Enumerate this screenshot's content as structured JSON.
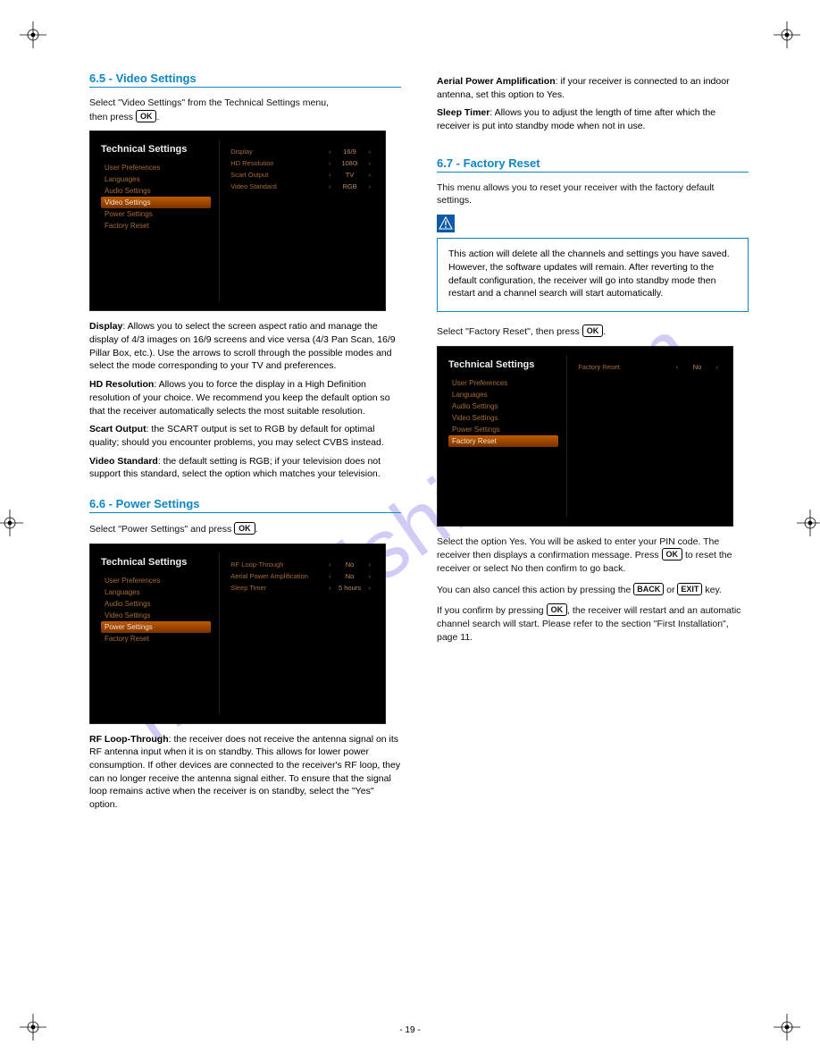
{
  "watermark": "manualshive.com",
  "left": {
    "section1_title": "6.5 - Video Settings",
    "section1_intro_a": "Select \"Video Settings\" from the Technical Settings menu,",
    "section1_intro_b": "then press ",
    "ok": "OK",
    "section1_intro_c": ".",
    "display_label": "Display",
    "display_body": ": Allows you to select the screen aspect ratio and manage the display of 4/3 images on 16/9 screens and vice versa (4/3 Pan Scan, 16/9 Pillar Box, etc.). Use the arrows to scroll through the possible modes and select the mode corresponding to your TV and preferences.",
    "hdres_label": "HD Resolution",
    "hdres_body": ": Allows you to force the display in a High Definition resolution of your choice. We recommend you keep the default option so that the receiver automatically selects the most suitable resolution.",
    "scart_label": "Scart Output",
    "scart_body": ": the SCART output is set to RGB by default for optimal quality; should you encounter problems, you may select CVBS instead.",
    "vstd_label": "Video Standard",
    "vstd_body": ": the default setting is RGB; if your television does not support this standard, select the option which matches your television.",
    "section2_title": "6.6 - Power Settings",
    "section2_intro_a": "Select \"Power Settings\" and press ",
    "rf_label": "RF Loop-Through",
    "rf_body": ": the receiver does not receive the antenna signal on its RF antenna input when it is on standby. This allows for lower power consumption. If other devices are connected to the receiver's RF loop, they can no longer receive the antenna signal either. To ensure that the signal loop remains active when the receiver is on standby, select the \"Yes\" option.",
    "screenshot1": {
      "title": "Technical Settings",
      "items": [
        "User Preferences",
        "Languages",
        "Audio Settings",
        "Video Settings",
        "Power Settings",
        "Factory Reset"
      ],
      "active_index": 3,
      "options": [
        {
          "label": "Display",
          "value": "16/9"
        },
        {
          "label": "HD Resolution",
          "value": "1080i"
        },
        {
          "label": "Scart Output",
          "value": "TV"
        },
        {
          "label": "Video Standard",
          "value": "RGB"
        }
      ]
    },
    "screenshot2": {
      "title": "Technical Settings",
      "items": [
        "User Preferences",
        "Languages",
        "Audio Settings",
        "Video Settings",
        "Power Settings",
        "Factory Reset"
      ],
      "active_index": 4,
      "options": [
        {
          "label": "RF Loop-Through",
          "value": "No"
        },
        {
          "label": "Aerial Power Amplification",
          "value": "No"
        },
        {
          "label": "Sleep Timer",
          "value": "5 hours"
        }
      ]
    }
  },
  "right": {
    "apa_label": "Aerial Power Amplification",
    "apa_body": ": if your receiver is connected to an indoor antenna, set this option to Yes.",
    "sleep_label": "Sleep Timer",
    "sleep_body": ": Allows you to adjust the length of time after which the receiver is put into standby mode when not in use.",
    "section_title": "6.7 - Factory Reset",
    "section_lead": "This menu allows you to reset your receiver with the factory default settings.",
    "warn_text": "This action will delete all the channels and settings you have saved. However, the software updates will remain. After reverting to the default configuration, the receiver will go into standby mode then restart and a channel search will start automatically.",
    "intro_a": "Select \"Factory Reset\", then press ",
    "screenshot3": {
      "title": "Technical Settings",
      "items": [
        "User Preferences",
        "Languages",
        "Audio Settings",
        "Video Settings",
        "Power Settings",
        "Factory Reset"
      ],
      "active_index": 5,
      "options": [
        {
          "label": "Factory Reset",
          "value": "No"
        }
      ]
    },
    "after1": "Select the option Yes. You will be asked to enter your PIN code. The receiver then displays a confirmation message. Press ",
    "after1b": " to reset the receiver or select No then confirm to go back.",
    "after2a": "You can also cancel this action by pressing the ",
    "back": "BACK",
    "after2b": " or ",
    "exit": "EXIT",
    "after2c": " key.",
    "after3a": "If you confirm by pressing ",
    "after3b": ", the receiver will restart and an automatic channel search will start. Please refer to the section \"First Installation\", page 11.",
    "footer": "- 19 -"
  }
}
